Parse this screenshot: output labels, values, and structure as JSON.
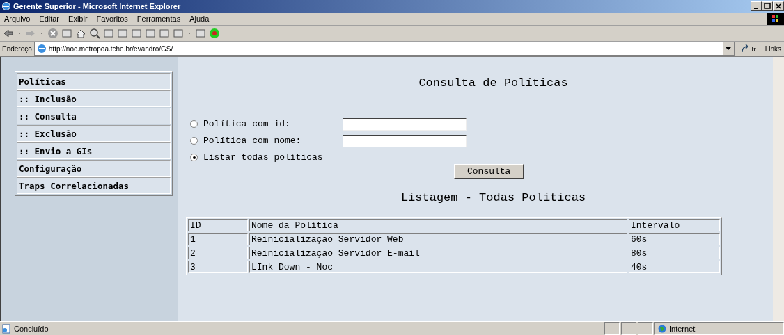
{
  "window": {
    "title": "Gerente Superior - Microsoft Internet Explorer"
  },
  "menu": [
    "Arquivo",
    "Editar",
    "Exibir",
    "Favoritos",
    "Ferramentas",
    "Ajuda"
  ],
  "address_bar": {
    "label": "Endereço",
    "url": "http://noc.metropoa.tche.br/evandro/GS/",
    "go": "Ir",
    "links": "Links"
  },
  "sidebar": {
    "items": [
      {
        "label": "Políticas"
      },
      {
        "label": ":: Inclusão"
      },
      {
        "label": ":: Consulta"
      },
      {
        "label": ":: Exclusão"
      },
      {
        "label": ":: Envio a GIs"
      },
      {
        "label": "Configuração"
      },
      {
        "label": "Traps Correlacionadas"
      }
    ]
  },
  "page_title": "Consulta de Políticas",
  "options": [
    {
      "label": "Política com id:",
      "selected": false,
      "has_field": true
    },
    {
      "label": "Política com nome:",
      "selected": false,
      "has_field": true
    },
    {
      "label": "Listar todas políticas",
      "selected": true,
      "has_field": false
    }
  ],
  "submit": "Consulta",
  "listing_title": "Listagem - Todas Políticas",
  "table": {
    "columns": [
      "ID",
      "Nome da Política",
      "Intervalo"
    ],
    "rows": [
      [
        "1",
        "Reinicialização Servidor Web",
        "60s"
      ],
      [
        "2",
        "Reinicialização Servidor E-mail",
        "80s"
      ],
      [
        "3",
        "LInk Down - Noc",
        "40s"
      ]
    ]
  },
  "status_bar": {
    "text": "Concluído",
    "zone": "Internet"
  }
}
